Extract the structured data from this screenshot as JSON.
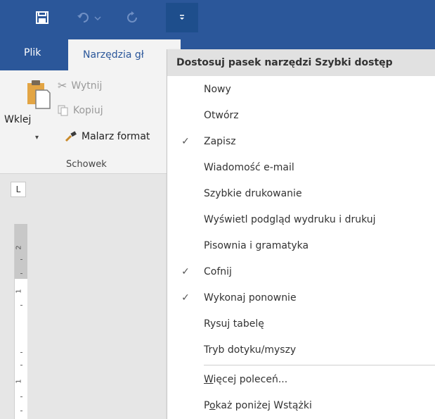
{
  "quick_access": {
    "save_icon": "floppy-disk-icon",
    "undo_icon": "undo-icon",
    "redo_icon": "redo-icon",
    "customize_icon": "customize-dropdown-icon"
  },
  "tabs": {
    "file": "Plik",
    "home_partial": "Narzędzia gł"
  },
  "ribbon": {
    "paste": "Wklej",
    "cut": "Wytnij",
    "copy": "Kopiuj",
    "format_painter": "Malarz format",
    "group_label": "Schowek"
  },
  "ruler": {
    "corner": "L",
    "numbers": [
      "2",
      "1",
      "1"
    ]
  },
  "menu": {
    "title": "Dostosuj pasek narzędzi Szybki dostęp",
    "items": [
      {
        "label": "Nowy",
        "checked": false
      },
      {
        "label": "Otwórz",
        "checked": false
      },
      {
        "label": "Zapisz",
        "checked": true
      },
      {
        "label": "Wiadomość e-mail",
        "checked": false
      },
      {
        "label": "Szybkie drukowanie",
        "checked": false
      },
      {
        "label": "Wyświetl podgląd wydruku i drukuj",
        "checked": false
      },
      {
        "label": "Pisownia i gramatyka",
        "checked": false
      },
      {
        "label": "Cofnij",
        "checked": true
      },
      {
        "label": "Wykonaj ponownie",
        "checked": true
      },
      {
        "label": "Rysuj tabelę",
        "checked": false
      },
      {
        "label": "Tryb dotyku/myszy",
        "checked": false
      }
    ],
    "more_commands": {
      "mnemonic": "W",
      "rest": "ięcej poleceń..."
    },
    "show_below": {
      "before": "P",
      "mnemonic": "o",
      "rest": "każ poniżej Wstążki"
    },
    "check_glyph": "✓"
  },
  "colors": {
    "title_bar": "#2b579a",
    "ribbon_bg": "#f3f3f3",
    "menu_header_bg": "#e1e1e1"
  }
}
